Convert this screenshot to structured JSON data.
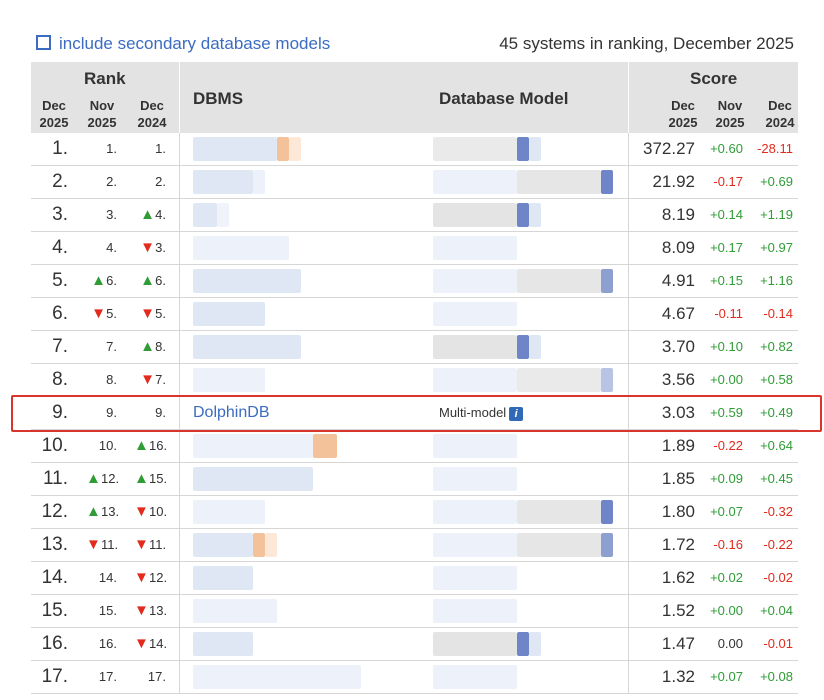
{
  "header": {
    "checkbox_label": "include secondary database models",
    "count_text": "45 systems in ranking, December 2025",
    "rank_label": "Rank",
    "dbms_label": "DBMS",
    "model_label": "Database Model",
    "score_label": "Score",
    "rank_cols": [
      {
        "month": "Dec",
        "year": "2025"
      },
      {
        "month": "Nov",
        "year": "2025"
      },
      {
        "month": "Dec",
        "year": "2024"
      }
    ],
    "score_cols": [
      {
        "month": "Dec",
        "year": "2025"
      },
      {
        "month": "Nov",
        "year": "2025"
      },
      {
        "month": "Dec",
        "year": "2024"
      }
    ]
  },
  "rows": [
    {
      "rank": "1.",
      "nov": "1.",
      "nov_trend": "",
      "dec24": "1.",
      "dec24_trend": "",
      "dbms": "",
      "model": "",
      "score": "372.27",
      "d_nov": "+0.60",
      "d_nov_sign": "pos",
      "d_dec": "-28.11",
      "d_dec_sign": "neg"
    },
    {
      "rank": "2.",
      "nov": "2.",
      "nov_trend": "",
      "dec24": "2.",
      "dec24_trend": "",
      "dbms": "",
      "model": "",
      "score": "21.92",
      "d_nov": "-0.17",
      "d_nov_sign": "neg",
      "d_dec": "+0.69",
      "d_dec_sign": "pos"
    },
    {
      "rank": "3.",
      "nov": "3.",
      "nov_trend": "",
      "dec24": "4.",
      "dec24_trend": "up",
      "dbms": "",
      "model": "",
      "score": "8.19",
      "d_nov": "+0.14",
      "d_nov_sign": "pos",
      "d_dec": "+1.19",
      "d_dec_sign": "pos"
    },
    {
      "rank": "4.",
      "nov": "4.",
      "nov_trend": "",
      "dec24": "3.",
      "dec24_trend": "down",
      "dbms": "",
      "model": "",
      "score": "8.09",
      "d_nov": "+0.17",
      "d_nov_sign": "pos",
      "d_dec": "+0.97",
      "d_dec_sign": "pos"
    },
    {
      "rank": "5.",
      "nov": "6.",
      "nov_trend": "up",
      "dec24": "6.",
      "dec24_trend": "up",
      "dbms": "",
      "model": "",
      "score": "4.91",
      "d_nov": "+0.15",
      "d_nov_sign": "pos",
      "d_dec": "+1.16",
      "d_dec_sign": "pos"
    },
    {
      "rank": "6.",
      "nov": "5.",
      "nov_trend": "down",
      "dec24": "5.",
      "dec24_trend": "down",
      "dbms": "",
      "model": "",
      "score": "4.67",
      "d_nov": "-0.11",
      "d_nov_sign": "neg",
      "d_dec": "-0.14",
      "d_dec_sign": "neg"
    },
    {
      "rank": "7.",
      "nov": "7.",
      "nov_trend": "",
      "dec24": "8.",
      "dec24_trend": "up",
      "dbms": "",
      "model": "",
      "score": "3.70",
      "d_nov": "+0.10",
      "d_nov_sign": "pos",
      "d_dec": "+0.82",
      "d_dec_sign": "pos"
    },
    {
      "rank": "8.",
      "nov": "8.",
      "nov_trend": "",
      "dec24": "7.",
      "dec24_trend": "down",
      "dbms": "",
      "model": "",
      "score": "3.56",
      "d_nov": "+0.00",
      "d_nov_sign": "pos",
      "d_dec": "+0.58",
      "d_dec_sign": "pos"
    },
    {
      "rank": "9.",
      "nov": "9.",
      "nov_trend": "",
      "dec24": "9.",
      "dec24_trend": "",
      "dbms": "DolphinDB",
      "model": "Multi-model",
      "score": "3.03",
      "d_nov": "+0.59",
      "d_nov_sign": "pos",
      "d_dec": "+0.49",
      "d_dec_sign": "pos"
    },
    {
      "rank": "10.",
      "nov": "10.",
      "nov_trend": "",
      "dec24": "16.",
      "dec24_trend": "up",
      "dbms": "",
      "model": "",
      "score": "1.89",
      "d_nov": "-0.22",
      "d_nov_sign": "neg",
      "d_dec": "+0.64",
      "d_dec_sign": "pos"
    },
    {
      "rank": "11.",
      "nov": "12.",
      "nov_trend": "up",
      "dec24": "15.",
      "dec24_trend": "up",
      "dbms": "",
      "model": "",
      "score": "1.85",
      "d_nov": "+0.09",
      "d_nov_sign": "pos",
      "d_dec": "+0.45",
      "d_dec_sign": "pos"
    },
    {
      "rank": "12.",
      "nov": "13.",
      "nov_trend": "up",
      "dec24": "10.",
      "dec24_trend": "down",
      "dbms": "",
      "model": "",
      "score": "1.80",
      "d_nov": "+0.07",
      "d_nov_sign": "pos",
      "d_dec": "-0.32",
      "d_dec_sign": "neg"
    },
    {
      "rank": "13.",
      "nov": "11.",
      "nov_trend": "down",
      "dec24": "11.",
      "dec24_trend": "down",
      "dbms": "",
      "model": "",
      "score": "1.72",
      "d_nov": "-0.16",
      "d_nov_sign": "neg",
      "d_dec": "-0.22",
      "d_dec_sign": "neg"
    },
    {
      "rank": "14.",
      "nov": "14.",
      "nov_trend": "",
      "dec24": "12.",
      "dec24_trend": "down",
      "dbms": "",
      "model": "",
      "score": "1.62",
      "d_nov": "+0.02",
      "d_nov_sign": "pos",
      "d_dec": "-0.02",
      "d_dec_sign": "neg"
    },
    {
      "rank": "15.",
      "nov": "15.",
      "nov_trend": "",
      "dec24": "13.",
      "dec24_trend": "down",
      "dbms": "",
      "model": "",
      "score": "1.52",
      "d_nov": "+0.00",
      "d_nov_sign": "pos",
      "d_dec": "+0.04",
      "d_dec_sign": "pos"
    },
    {
      "rank": "16.",
      "nov": "16.",
      "nov_trend": "",
      "dec24": "14.",
      "dec24_trend": "down",
      "dbms": "",
      "model": "",
      "score": "1.47",
      "d_nov": "0.00",
      "d_nov_sign": "zero",
      "d_dec": "-0.01",
      "d_dec_sign": "neg"
    },
    {
      "rank": "17.",
      "nov": "17.",
      "nov_trend": "",
      "dec24": "17.",
      "dec24_trend": "",
      "dbms": "",
      "model": "",
      "score": "1.32",
      "d_nov": "+0.07",
      "d_nov_sign": "pos",
      "d_dec": "+0.08",
      "d_dec_sign": "pos"
    }
  ],
  "icons": {
    "up": "arrow-up-icon",
    "down": "arrow-down-icon",
    "info": "info-icon"
  },
  "colors": {
    "link": "#3b6cc2",
    "positive": "#2f9c36",
    "negative": "#e22b1d",
    "highlight": "#d9352c",
    "header_bg": "#e3e3e3"
  }
}
